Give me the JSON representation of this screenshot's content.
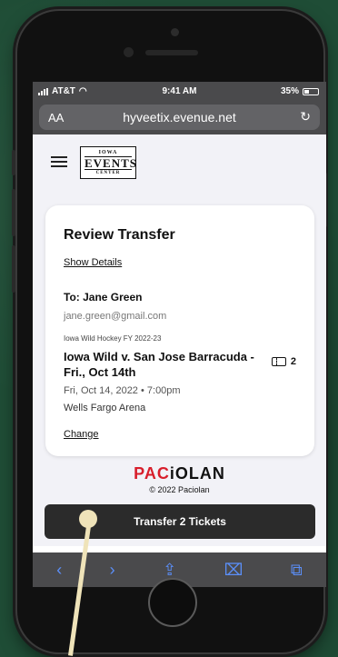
{
  "status_bar": {
    "carrier": "AT&T",
    "time": "9:41 AM",
    "battery": "35%"
  },
  "browser": {
    "text_size_label": "AA",
    "url": "hyveetix.evenue.net",
    "reload_icon": "reload-icon"
  },
  "header": {
    "menu_icon": "hamburger-menu-icon",
    "logo": {
      "top": "IOWA",
      "main": "EVENTS",
      "bottom": "CENTER"
    }
  },
  "transfer": {
    "title": "Review Transfer",
    "show_details": "Show Details",
    "to_label": "To: Jane Green",
    "email": "jane.green@gmail.com",
    "event_series": "Iowa Wild Hockey FY 2022-23",
    "event_name": "Iowa Wild v. San Jose Barracuda - Fri., Oct 14th",
    "ticket_count": "2",
    "date": "Fri, Oct 14, 2022 • 7:00pm",
    "venue": "Wells Fargo Arena",
    "change": "Change"
  },
  "footer": {
    "brand_red": "PAC",
    "brand_dark": "iOLAN",
    "copyright": "© 2022 Paciolan"
  },
  "actions": {
    "transfer_button": "Transfer 2 Tickets"
  },
  "toolbar": {
    "back": "‹",
    "forward": "›",
    "share": "⇪",
    "bookmarks": "⌧",
    "tabs": "⧉"
  },
  "colors": {
    "background": "#1f4d36",
    "brand_red": "#d81e2b",
    "toolbar_icons": "#5b8ff9",
    "button": "#2b2b2b"
  }
}
